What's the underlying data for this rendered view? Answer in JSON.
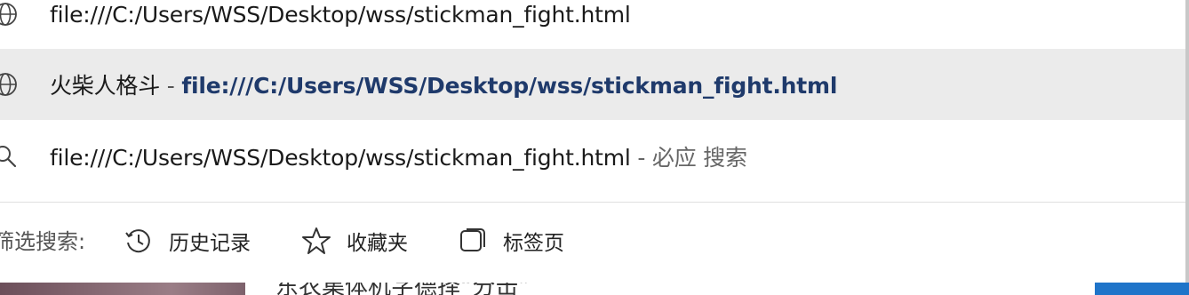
{
  "suggestions": [
    {
      "type": "url",
      "icon": "globe-icon",
      "text": "file:///C:/Users/WSS/Desktop/wss/stickman_fight.html"
    },
    {
      "type": "history",
      "icon": "globe-icon",
      "title": "火柴人格斗",
      "separator": " - ",
      "url": "file:///C:/Users/WSS/Desktop/wss/stickman_fight.html"
    },
    {
      "type": "search",
      "icon": "search-icon",
      "text": "file:///C:/Users/WSS/Desktop/wss/stickman_fight.html",
      "suffix": " - 必应 搜索"
    }
  ],
  "filter_bar": {
    "label": "筛选搜索:",
    "buttons": [
      {
        "icon": "history-clock-icon",
        "label": "历史记录"
      },
      {
        "icon": "star-icon",
        "label": "收藏夹"
      },
      {
        "icon": "tabs-icon",
        "label": "标签页"
      }
    ]
  },
  "underlying_page": {
    "partial_text": "东农集体机字德择“分击”"
  },
  "colors": {
    "highlight": "#ebebeb",
    "url_bold": "#1f3a6b",
    "accent_blue": "#1f74c9"
  }
}
